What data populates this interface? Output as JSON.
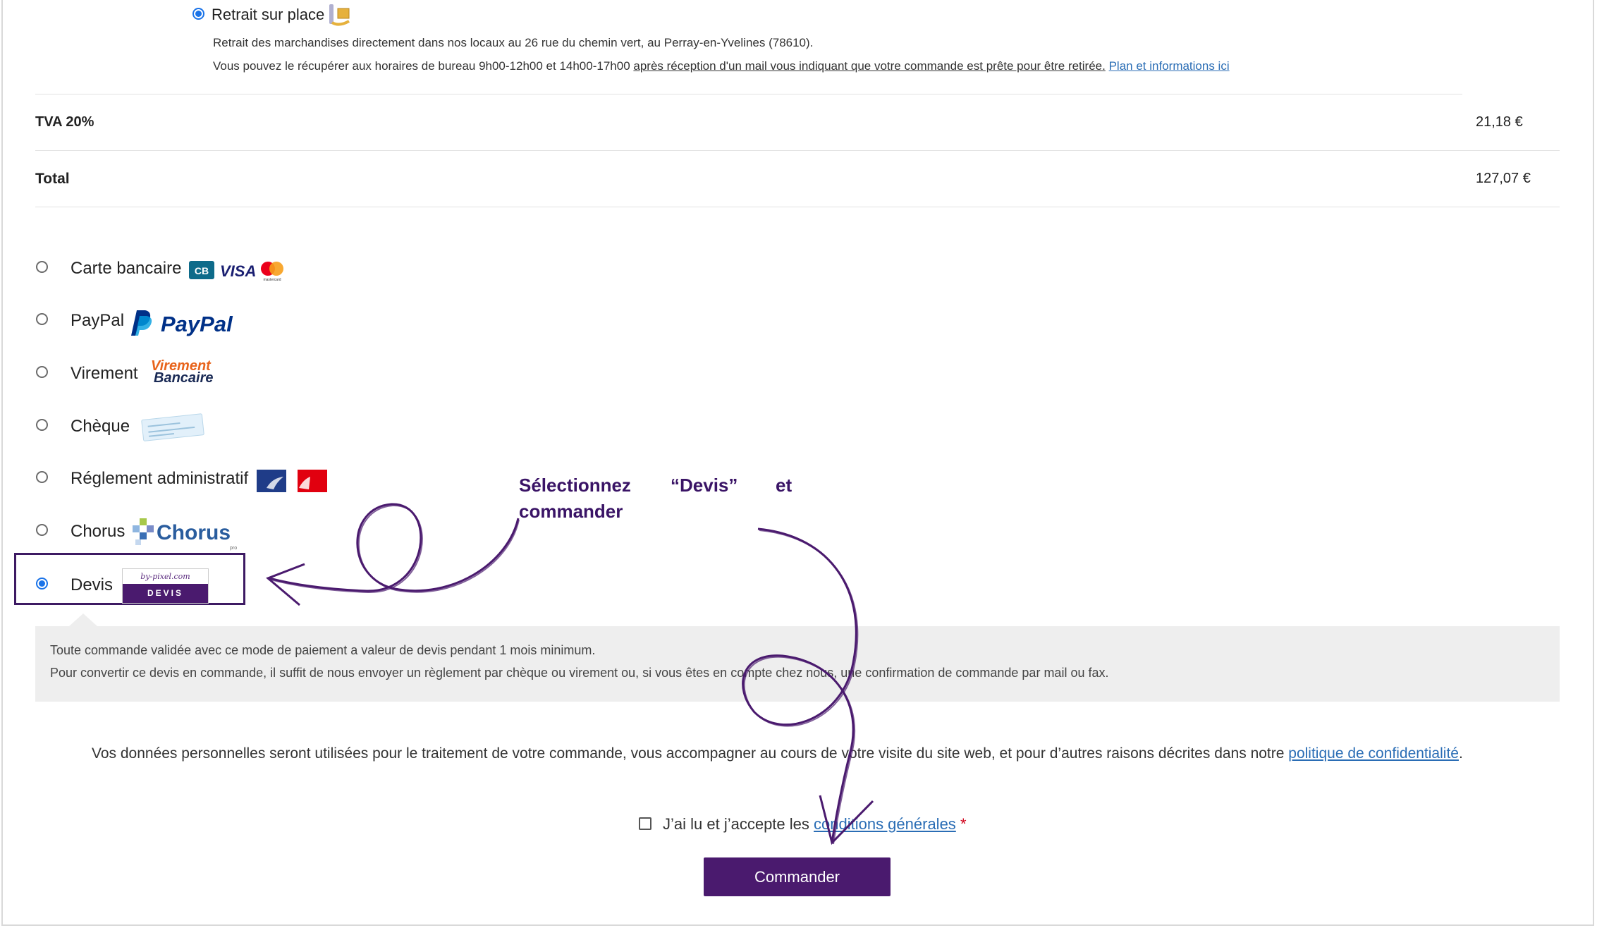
{
  "shipping": {
    "option_label": "Retrait sur place",
    "line1": "Retrait des marchandises directement dans nos locaux au 26 rue du chemin vert, au Perray-en-Yvelines (78610).",
    "line2_start": "Vous pouvez le récupérer aux horaires de bureau 9h00-12h00 et 14h00-17h00",
    "line2_underlined": "après réception d'un mail vous indiquant que votre commande est prête pour être retirée.",
    "line2_link": "Plan et informations ici"
  },
  "totals": {
    "tva_label": "TVA 20%",
    "tva_value": "21,18 €",
    "total_label": "Total",
    "total_value": "127,07 €"
  },
  "payment_methods": [
    {
      "label": "Carte bancaire",
      "selected": false,
      "icon": "card-logos-icon"
    },
    {
      "label": "PayPal",
      "selected": false,
      "icon": "paypal-logo-icon",
      "logo_text": "PayPal"
    },
    {
      "label": "Virement",
      "selected": false,
      "icon": "virement-logo-icon",
      "logo_line1": "Virement",
      "logo_line2": "Bancaire"
    },
    {
      "label": "Chèque",
      "selected": false,
      "icon": "cheque-icon"
    },
    {
      "label": "Réglement administratif",
      "selected": false,
      "icon": "republique-logo-icon"
    },
    {
      "label": "Chorus",
      "selected": false,
      "icon": "chorus-logo-icon",
      "logo_text": "Chorus",
      "logo_sub": "pro"
    },
    {
      "label": "Devis",
      "selected": true,
      "icon": "devis-logo-icon",
      "logo_top": "by-pixel.com",
      "logo_bottom": "DEVIS"
    }
  ],
  "card_logos": {
    "cb": "CB",
    "visa": "VISA",
    "mastercard": "mastercard"
  },
  "devis_info": {
    "line1": "Toute commande validée avec ce mode de paiement a valeur de devis pendant 1 mois minimum.",
    "line2": "Pour convertir ce devis en commande, il suffit de nous envoyer un règlement par chèque ou virement ou, si vous êtes en compte chez nous, une confirmation de commande par mail ou fax."
  },
  "privacy": {
    "text": "Vos données personnelles seront utilisées pour le traitement de votre commande, vous accompagner au cours de votre visite du site web, et pour d’autres raisons décrites dans notre ",
    "link": "politique de confidentialité",
    "end": "."
  },
  "terms": {
    "text": "J’ai lu et j’accepte les ",
    "link": "conditions générales",
    "required_mark": "*"
  },
  "order_button": "Commander",
  "annotation": {
    "w1": "Sélectionnez",
    "w2": "“Devis”",
    "w3": "et",
    "line2": "commander"
  },
  "colors": {
    "accent": "#4a1a6e",
    "radio_selected": "#1a73e8",
    "link": "#2a6db5",
    "annotation": "#3a1466",
    "required": "#d0021b"
  }
}
